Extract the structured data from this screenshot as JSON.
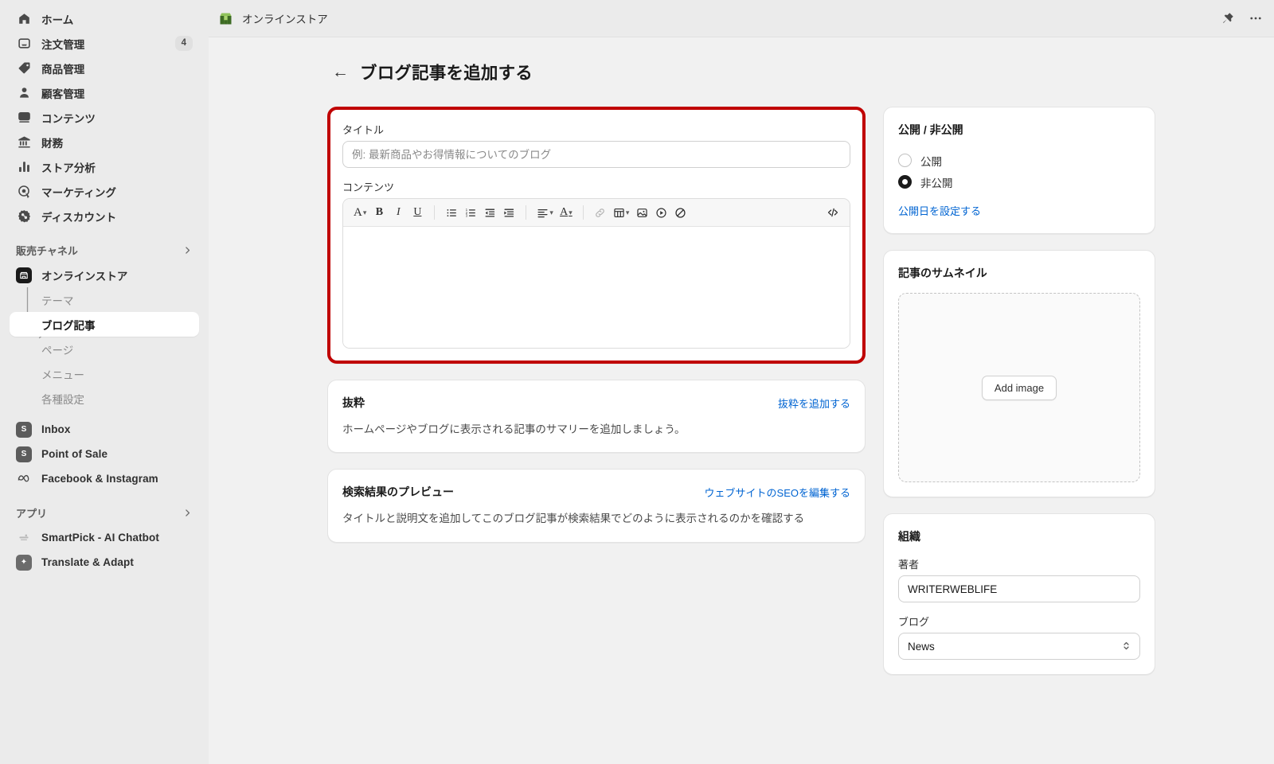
{
  "sidebar": {
    "nav": [
      {
        "label": "ホーム",
        "icon": "home-icon",
        "badge": null
      },
      {
        "label": "注文管理",
        "icon": "orders-inbox-icon",
        "badge": "4"
      },
      {
        "label": "商品管理",
        "icon": "product-tag-icon",
        "badge": null
      },
      {
        "label": "顧客管理",
        "icon": "customer-person-icon",
        "badge": null
      },
      {
        "label": "コンテンツ",
        "icon": "content-image-icon",
        "badge": null
      },
      {
        "label": "財務",
        "icon": "finance-bank-icon",
        "badge": null
      },
      {
        "label": "ストア分析",
        "icon": "analytics-bars-icon",
        "badge": null
      },
      {
        "label": "マーケティング",
        "icon": "marketing-target-icon",
        "badge": null
      },
      {
        "label": "ディスカウント",
        "icon": "discount-badge-icon",
        "badge": null
      }
    ],
    "sales_channel_section": {
      "label": "販売チャネル",
      "chevron": "chevron-right-icon"
    },
    "online_store": {
      "label": "オンラインストア",
      "icon": "online-store-icon"
    },
    "online_store_children": [
      {
        "label": "テーマ",
        "active": false
      },
      {
        "label": "ブログ記事",
        "active": true
      },
      {
        "label": "ページ",
        "active": false
      },
      {
        "label": "メニュー",
        "active": false
      },
      {
        "label": "各種設定",
        "active": false
      }
    ],
    "channels": [
      {
        "label": "Inbox",
        "icon": "inbox-app-icon",
        "glyph": "S"
      },
      {
        "label": "Point of Sale",
        "icon": "point-of-sale-app-icon",
        "glyph": "S"
      },
      {
        "label": "Facebook & Instagram",
        "icon": "meta-infinity-icon",
        "glyph": "∞"
      }
    ],
    "apps_section": {
      "label": "アプリ",
      "chevron": "chevron-right-icon"
    },
    "apps": [
      {
        "label": "SmartPick - AI Chatbot",
        "icon": "smartpick-app-icon",
        "glyph": ""
      },
      {
        "label": "Translate & Adapt",
        "icon": "translate-adapt-app-icon",
        "glyph": "✦"
      }
    ]
  },
  "topbar": {
    "store_name": "オンラインストア",
    "logo_icon": "storefront-logo-icon",
    "pin_icon": "pushpin-icon",
    "more_icon": "more-horizontal-icon"
  },
  "page": {
    "back_icon": "back-arrow-icon",
    "title": "ブログ記事を追加する"
  },
  "main": {
    "title_field": {
      "label": "タイトル",
      "value": "",
      "placeholder": "例: 最新商品やお得情報についてのブログ"
    },
    "content_field": {
      "label": "コンテンツ",
      "value": ""
    },
    "toolbar": [
      {
        "name": "font-style-icon",
        "glyph": "A",
        "chevron": true,
        "dim": false
      },
      {
        "name": "bold-icon",
        "glyph": "B",
        "chevron": false,
        "dim": false
      },
      {
        "name": "italic-icon",
        "glyph": "I",
        "chevron": false,
        "dim": false
      },
      {
        "name": "underline-icon",
        "glyph": "U",
        "chevron": false,
        "dim": false
      },
      {
        "name": "bulleted-list-icon",
        "glyph": "",
        "chevron": false,
        "dim": false
      },
      {
        "name": "numbered-list-icon",
        "glyph": "",
        "chevron": false,
        "dim": false
      },
      {
        "name": "outdent-icon",
        "glyph": "",
        "chevron": false,
        "dim": false
      },
      {
        "name": "indent-icon",
        "glyph": "",
        "chevron": false,
        "dim": false
      },
      {
        "name": "align-icon",
        "glyph": "",
        "chevron": true,
        "dim": false
      },
      {
        "name": "text-color-icon",
        "glyph": "A",
        "chevron": true,
        "dim": false
      },
      {
        "name": "link-icon",
        "glyph": "",
        "chevron": false,
        "dim": true
      },
      {
        "name": "table-icon",
        "glyph": "",
        "chevron": true,
        "dim": false
      },
      {
        "name": "insert-image-icon",
        "glyph": "",
        "chevron": false,
        "dim": false
      },
      {
        "name": "insert-video-icon",
        "glyph": "",
        "chevron": false,
        "dim": false
      },
      {
        "name": "clear-formatting-icon",
        "glyph": "",
        "chevron": false,
        "dim": false
      },
      {
        "name": "code-view-icon",
        "glyph": "",
        "chevron": false,
        "dim": false
      }
    ],
    "excerpt_card": {
      "title": "抜粋",
      "link": "抜粋を追加する",
      "body": "ホームページやブログに表示される記事のサマリーを追加しましょう。"
    },
    "seo_card": {
      "title": "検索結果のプレビュー",
      "link": "ウェブサイトのSEOを編集する",
      "body": "タイトルと説明文を追加してこのブログ記事が検索結果でどのように表示されるのかを確認する"
    }
  },
  "right": {
    "visibility": {
      "title": "公開 / 非公開",
      "options": [
        {
          "label": "公開",
          "selected": false
        },
        {
          "label": "非公開",
          "selected": true
        }
      ],
      "link": "公開日を設定する"
    },
    "thumbnail": {
      "title": "記事のサムネイル",
      "button": "Add image"
    },
    "organization": {
      "title": "組織",
      "author_label": "著者",
      "author_value": "WRITERWEBLIFE",
      "blog_label": "ブログ",
      "blog_value": "News"
    }
  },
  "colors": {
    "highlight_border": "#c00000",
    "link": "#0064d2",
    "sidebar_bg": "#ebebeb",
    "canvas_bg": "#f1f1f1",
    "brand_green": "#5a8f32"
  }
}
